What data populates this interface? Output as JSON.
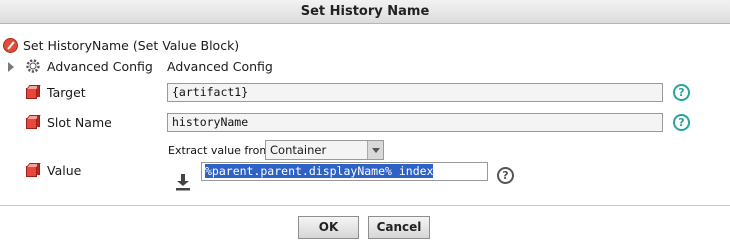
{
  "dialog": {
    "title": "Set  History Name"
  },
  "block": {
    "label": "Set HistoryName  (Set Value Block)"
  },
  "advanced": {
    "label": "Advanced Config",
    "value": "Advanced Config"
  },
  "target": {
    "label": "Target",
    "value": "{artifact1}"
  },
  "slot": {
    "label": "Slot Name",
    "value": "historyName"
  },
  "value_row": {
    "label": "Value",
    "extract_label": "Extract value from:",
    "extract_selected": "Container",
    "value": "%parent.parent.displayName% index"
  },
  "help": {
    "symbol": "?"
  },
  "buttons": {
    "ok": "OK",
    "cancel": "Cancel"
  },
  "colors": {
    "help_teal": "#2aa39a",
    "selection_blue": "#2f62c7",
    "cube_red": "#e8463a"
  }
}
